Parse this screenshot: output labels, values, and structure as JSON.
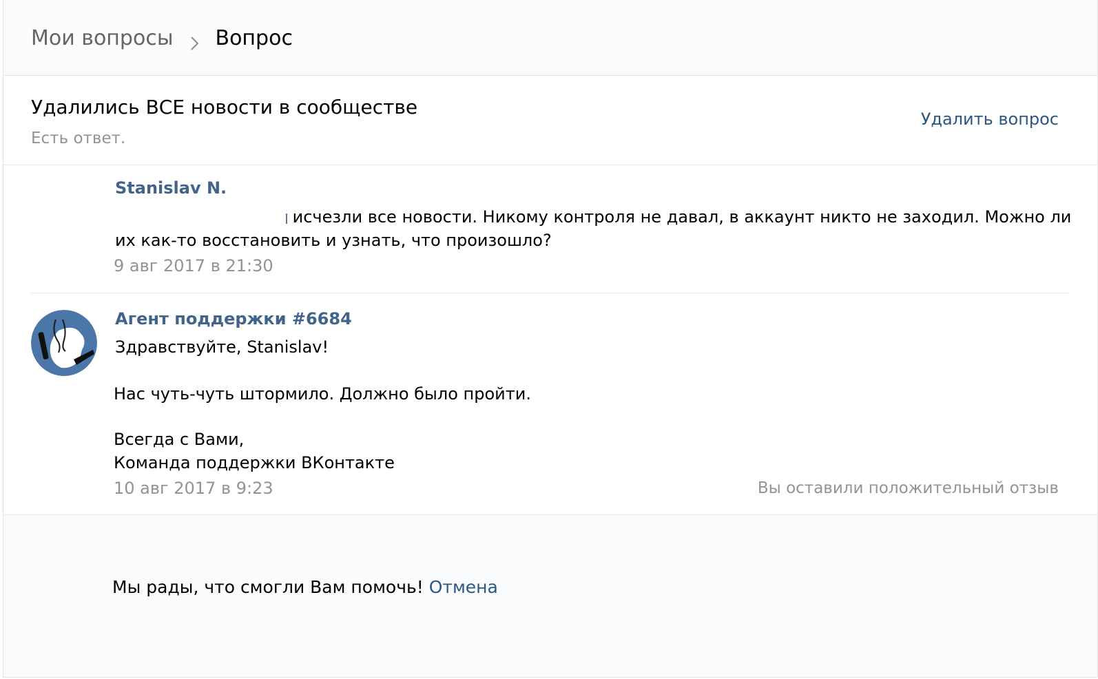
{
  "breadcrumb": {
    "parent": "Мои вопросы",
    "current": "Вопрос",
    "separator_icon": "chevron-right-icon"
  },
  "question": {
    "title": "Удалились ВСЕ новости в сообществе",
    "status": "Есть ответ.",
    "delete_label": "Удалить вопрос"
  },
  "messages": [
    {
      "author": "Stanislav N.",
      "text_line1": "исчезли все новости. Никому контроля не давал, в аккаунт никто не заходил. Можно ли",
      "text_line2": "их как-то восстановить и узнать, что произошло?",
      "date": "9 авг 2017 в 21:30"
    },
    {
      "author": "Агент поддержки #6684",
      "greeting": "Здравствуйте, Stanislav!",
      "body": "Нас чуть-чуть штормило. Должно было пройти.",
      "sign1": "Всегда с Вами,",
      "sign2": "Команда поддержки ВКонтакте",
      "date": "10 авг 2017 в 9:23",
      "feedback": "Вы оставили положительный отзыв",
      "avatar_icon": "support-agent-avatar"
    }
  ],
  "footer": {
    "thanks": "Мы рады, что смогли Вам помочь!",
    "cancel_label": "Отмена"
  },
  "colors": {
    "link": "#2a5885",
    "author": "#42648b",
    "muted": "#939393",
    "avatar_bg": "#4a76a8"
  }
}
